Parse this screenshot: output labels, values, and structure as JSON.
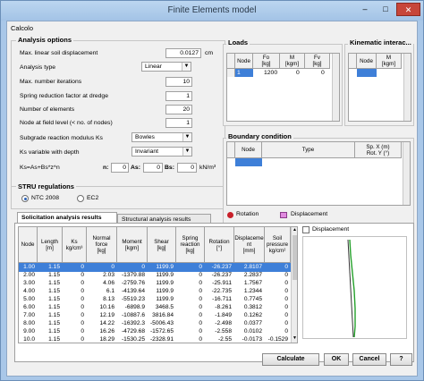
{
  "window": {
    "title": "Finite Elements model",
    "min": "‒",
    "max": "□",
    "close": "✕"
  },
  "menu": {
    "calcolo": "Calcolo"
  },
  "analysis": {
    "title": "Analysis options",
    "fields": [
      {
        "label": "Max. linear soil displacement",
        "value": "0.0127",
        "unit": "cm"
      },
      {
        "label": "Analysis type",
        "value": "Linear"
      },
      {
        "label": "Max. number iterations",
        "value": "10"
      },
      {
        "label": "Spring reduction factor at dredge",
        "value": "1"
      },
      {
        "label": "Number of elements",
        "value": "20"
      },
      {
        "label": "Node at field level (< no. of nodes)",
        "value": "1"
      },
      {
        "label": "Subgrade reaction modulus Ks",
        "value": "Bowles"
      },
      {
        "label": "Ks variable with depth",
        "value": "Invariant"
      }
    ],
    "formula": "Ks=As+Bs*z^n",
    "n_label": "n:",
    "n_value": "0",
    "as_label": "As:",
    "as_value": "0",
    "bs_label": "Bs:",
    "bs_value": "0",
    "bs_unit": "kN/m³"
  },
  "stru": {
    "title": "STRU regulations",
    "opt1": "NTC 2008",
    "opt2": "EC2"
  },
  "loads": {
    "title": "Loads",
    "headers": [
      "Node",
      "Fo\n[kg]",
      "M\n[kgm]",
      "Fv\n[kg]"
    ],
    "row": [
      "1",
      "1200",
      "0",
      "0"
    ]
  },
  "kin": {
    "title": "Kinematic interac...",
    "headers": [
      "Node",
      "M\n[kgm]"
    ]
  },
  "boundary": {
    "title": "Boundary condition",
    "headers": [
      "Node",
      "Type",
      "Sp. X (m)\nRot. Y (°)"
    ],
    "legend_rotation": "Rotation",
    "legend_displacement": "Displacement"
  },
  "results": {
    "tab1": "Solicitation analysis results",
    "tab2": "Structural analysis results",
    "headers": [
      "Node",
      "Length\n[m]",
      "Ks\nkg/cm³",
      "Normal\nforce\n[kg]",
      "Moment\n[kgm]",
      "Shear\n[kg]",
      "Spring\nreaction\n[kg]",
      "Rotation\n[°]",
      "Displaceme\nnt\n[mm]",
      "Soil\npressure\nkg/cm²"
    ],
    "rows": [
      [
        "1.00",
        "1.15",
        "0",
        "0",
        "0",
        "1199.9",
        "0",
        "-26.237",
        "2.8107",
        "0"
      ],
      [
        "2.00",
        "1.15",
        "0",
        "2.03",
        "-1379.88",
        "1199.9",
        "0",
        "-26.237",
        "2.2837",
        "0"
      ],
      [
        "3.00",
        "1.15",
        "0",
        "4.06",
        "-2759.76",
        "1199.9",
        "0",
        "-25.911",
        "1.7567",
        "0"
      ],
      [
        "4.00",
        "1.15",
        "0",
        "6.1",
        "-4139.64",
        "1199.9",
        "0",
        "-22.735",
        "1.2344",
        "0"
      ],
      [
        "5.00",
        "1.15",
        "0",
        "8.13",
        "-5519.23",
        "1199.9",
        "0",
        "-16.711",
        "0.7745",
        "0"
      ],
      [
        "6.00",
        "1.15",
        "0",
        "10.16",
        "-6898.9",
        "3468.5",
        "0",
        "-8.261",
        "0.3812",
        "0"
      ],
      [
        "7.00",
        "1.15",
        "0",
        "12.19",
        "-10887.6",
        "3816.84",
        "0",
        "-1.849",
        "0.1262",
        "0"
      ],
      [
        "8.00",
        "1.15",
        "0",
        "14.22",
        "-16392.3",
        "-5006.43",
        "0",
        "-2.498",
        "0.0377",
        "0"
      ],
      [
        "9.00",
        "1.15",
        "0",
        "16.26",
        "-4729.68",
        "-1572.65",
        "0",
        "-2.558",
        "0.0102",
        "0"
      ],
      [
        "10.0",
        "1.15",
        "0",
        "18.29",
        "-1530.25",
        "-2328.91",
        "0",
        "-2.55",
        "-0.0173",
        "-0.1529"
      ]
    ],
    "displacement_cb": "Displacement"
  },
  "buttons": {
    "calculate": "Calculate",
    "ok": "OK",
    "cancel": "Cancel",
    "help": "?"
  }
}
